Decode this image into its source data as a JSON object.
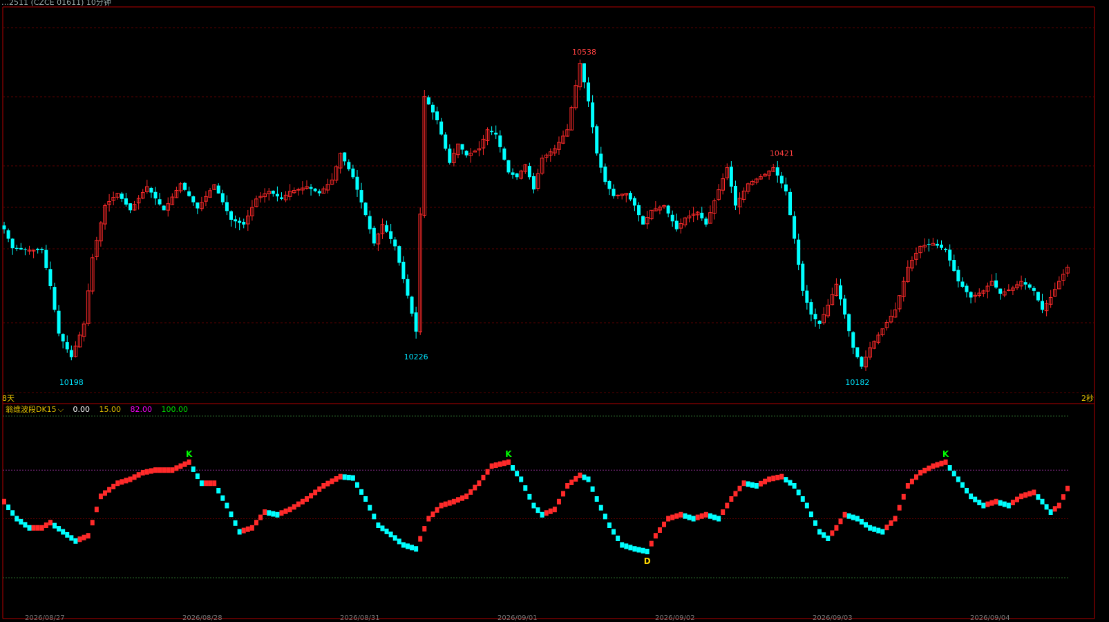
{
  "title": "…2511 (CZCE 01611) 10分钟",
  "colors": {
    "up": "#ff2a2a",
    "down": "#00ffff",
    "frame": "#b40000",
    "grid": "#5a0000",
    "high_label": "#ff4040",
    "low_label": "#00e5ff",
    "ind_zero": "#ffffff",
    "ind_15": "#e6c300",
    "ind_82": "#ff00ff",
    "ind_100": "#00dd00"
  },
  "cycle_left": "8天",
  "cycle_right": "2秒",
  "indicator": {
    "name": "翁维波段DK15",
    "values": [
      "0.00",
      "15.00",
      "82.00",
      "100.00"
    ],
    "markers": [
      {
        "label": "K",
        "index": 44,
        "color": "#00ff00"
      },
      {
        "label": "K",
        "index": 120,
        "color": "#00ff00"
      },
      {
        "label": "D",
        "index": 153,
        "color": "#ffd700"
      },
      {
        "label": "K",
        "index": 224,
        "color": "#00ff00"
      }
    ]
  },
  "chart_data": {
    "type": "candlestick",
    "price_annotations": [
      {
        "text": "10538",
        "index": 138,
        "kind": "high"
      },
      {
        "text": "10421",
        "index": 185,
        "kind": "high"
      },
      {
        "text": "10226",
        "index": 98,
        "kind": "low"
      },
      {
        "text": "10198",
        "index": 16,
        "kind": "low"
      },
      {
        "text": "10182",
        "index": 203,
        "kind": "low"
      }
    ],
    "ylim": [
      10175,
      10560
    ],
    "anchors": [
      [
        0,
        10340
      ],
      [
        2,
        10320
      ],
      [
        5,
        10318
      ],
      [
        9,
        10318
      ],
      [
        11,
        10280
      ],
      [
        13,
        10230
      ],
      [
        16,
        10205
      ],
      [
        19,
        10240
      ],
      [
        21,
        10310
      ],
      [
        24,
        10365
      ],
      [
        27,
        10378
      ],
      [
        30,
        10360
      ],
      [
        34,
        10385
      ],
      [
        38,
        10360
      ],
      [
        42,
        10388
      ],
      [
        46,
        10362
      ],
      [
        50,
        10387
      ],
      [
        54,
        10350
      ],
      [
        57,
        10345
      ],
      [
        60,
        10372
      ],
      [
        63,
        10380
      ],
      [
        66,
        10372
      ],
      [
        68,
        10380
      ],
      [
        70,
        10382
      ],
      [
        72,
        10385
      ],
      [
        75,
        10378
      ],
      [
        78,
        10392
      ],
      [
        80,
        10420
      ],
      [
        83,
        10395
      ],
      [
        86,
        10355
      ],
      [
        88,
        10325
      ],
      [
        90,
        10345
      ],
      [
        93,
        10322
      ],
      [
        96,
        10270
      ],
      [
        98,
        10232
      ],
      [
        100,
        10480
      ],
      [
        103,
        10455
      ],
      [
        106,
        10410
      ],
      [
        108,
        10430
      ],
      [
        110,
        10418
      ],
      [
        113,
        10425
      ],
      [
        115,
        10445
      ],
      [
        117,
        10440
      ],
      [
        120,
        10400
      ],
      [
        122,
        10395
      ],
      [
        124,
        10408
      ],
      [
        126,
        10382
      ],
      [
        128,
        10415
      ],
      [
        131,
        10425
      ],
      [
        134,
        10445
      ],
      [
        137,
        10515
      ],
      [
        139,
        10475
      ],
      [
        141,
        10420
      ],
      [
        143,
        10390
      ],
      [
        145,
        10375
      ],
      [
        148,
        10378
      ],
      [
        150,
        10365
      ],
      [
        152,
        10345
      ],
      [
        154,
        10360
      ],
      [
        157,
        10365
      ],
      [
        160,
        10340
      ],
      [
        162,
        10352
      ],
      [
        165,
        10358
      ],
      [
        167,
        10345
      ],
      [
        169,
        10370
      ],
      [
        172,
        10405
      ],
      [
        174,
        10365
      ],
      [
        177,
        10388
      ],
      [
        181,
        10398
      ],
      [
        183,
        10405
      ],
      [
        186,
        10380
      ],
      [
        188,
        10330
      ],
      [
        190,
        10275
      ],
      [
        192,
        10250
      ],
      [
        194,
        10240
      ],
      [
        196,
        10260
      ],
      [
        198,
        10282
      ],
      [
        200,
        10250
      ],
      [
        202,
        10215
      ],
      [
        204,
        10195
      ],
      [
        206,
        10215
      ],
      [
        209,
        10235
      ],
      [
        212,
        10255
      ],
      [
        215,
        10300
      ],
      [
        218,
        10322
      ],
      [
        221,
        10325
      ],
      [
        224,
        10318
      ],
      [
        227,
        10285
      ],
      [
        230,
        10268
      ],
      [
        233,
        10275
      ],
      [
        235,
        10285
      ],
      [
        237,
        10272
      ],
      [
        240,
        10278
      ],
      [
        242,
        10285
      ],
      [
        245,
        10275
      ],
      [
        247,
        10255
      ],
      [
        249,
        10268
      ],
      [
        251,
        10285
      ],
      [
        253,
        10300
      ]
    ],
    "indicator_anchors": [
      [
        0,
        58
      ],
      [
        3,
        45
      ],
      [
        6,
        38
      ],
      [
        9,
        38
      ],
      [
        11,
        42
      ],
      [
        14,
        35
      ],
      [
        17,
        28
      ],
      [
        20,
        32
      ],
      [
        23,
        62
      ],
      [
        27,
        72
      ],
      [
        30,
        75
      ],
      [
        33,
        80
      ],
      [
        36,
        82
      ],
      [
        40,
        82
      ],
      [
        44,
        88
      ],
      [
        47,
        72
      ],
      [
        50,
        72
      ],
      [
        53,
        55
      ],
      [
        56,
        35
      ],
      [
        59,
        38
      ],
      [
        62,
        50
      ],
      [
        65,
        48
      ],
      [
        68,
        52
      ],
      [
        72,
        60
      ],
      [
        76,
        70
      ],
      [
        80,
        77
      ],
      [
        83,
        76
      ],
      [
        86,
        60
      ],
      [
        89,
        40
      ],
      [
        92,
        33
      ],
      [
        95,
        25
      ],
      [
        98,
        22
      ],
      [
        101,
        45
      ],
      [
        104,
        55
      ],
      [
        107,
        58
      ],
      [
        110,
        62
      ],
      [
        113,
        72
      ],
      [
        116,
        85
      ],
      [
        120,
        88
      ],
      [
        123,
        75
      ],
      [
        126,
        55
      ],
      [
        128,
        48
      ],
      [
        131,
        52
      ],
      [
        134,
        70
      ],
      [
        137,
        78
      ],
      [
        139,
        75
      ],
      [
        141,
        60
      ],
      [
        144,
        40
      ],
      [
        147,
        25
      ],
      [
        150,
        22
      ],
      [
        153,
        20
      ],
      [
        155,
        32
      ],
      [
        158,
        45
      ],
      [
        161,
        48
      ],
      [
        164,
        45
      ],
      [
        167,
        48
      ],
      [
        170,
        45
      ],
      [
        173,
        60
      ],
      [
        176,
        72
      ],
      [
        179,
        70
      ],
      [
        182,
        75
      ],
      [
        185,
        77
      ],
      [
        188,
        70
      ],
      [
        191,
        55
      ],
      [
        194,
        35
      ],
      [
        196,
        30
      ],
      [
        198,
        38
      ],
      [
        200,
        48
      ],
      [
        203,
        45
      ],
      [
        206,
        38
      ],
      [
        209,
        35
      ],
      [
        212,
        45
      ],
      [
        215,
        70
      ],
      [
        218,
        80
      ],
      [
        221,
        85
      ],
      [
        224,
        88
      ],
      [
        227,
        75
      ],
      [
        230,
        62
      ],
      [
        233,
        55
      ],
      [
        236,
        58
      ],
      [
        239,
        55
      ],
      [
        242,
        62
      ],
      [
        245,
        65
      ],
      [
        247,
        58
      ],
      [
        249,
        50
      ],
      [
        251,
        55
      ],
      [
        253,
        68
      ]
    ],
    "xlabels": [
      "2026/08/27",
      "2026/08/28",
      "2026/08/31",
      "2026/09/01",
      "2026/09/02",
      "2026/09/03",
      "2026/09/04"
    ]
  }
}
